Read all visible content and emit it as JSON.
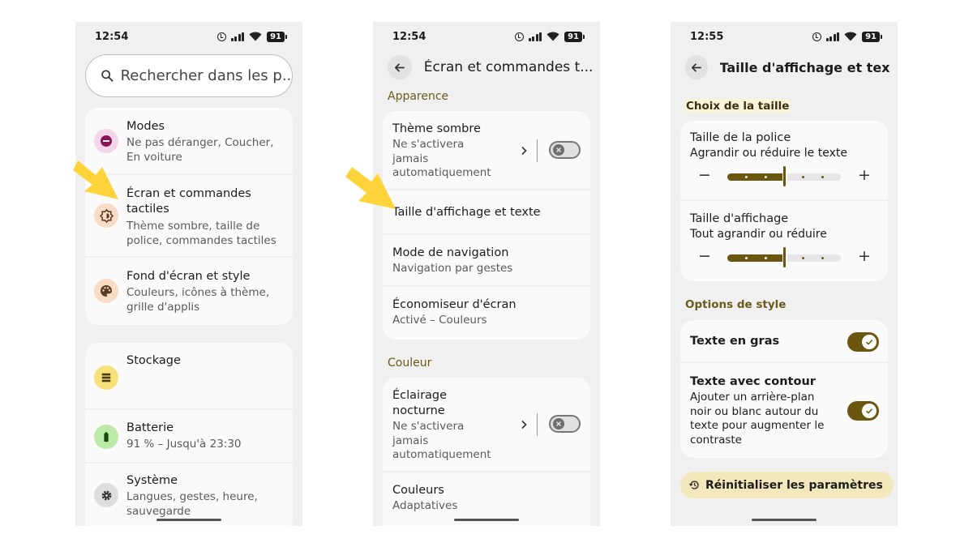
{
  "colors": {
    "accent": "#6b560f",
    "arrow": "#ffd43b",
    "section": "#6b5a1a",
    "highlight": "#fbf4dd"
  },
  "status": [
    {
      "time": "12:54",
      "battery": "91"
    },
    {
      "time": "12:54",
      "battery": "91"
    },
    {
      "time": "12:55",
      "battery": "91"
    }
  ],
  "screen1": {
    "search_placeholder": "Rechercher dans les p...",
    "items": [
      {
        "title": "Modes",
        "subtitle": "Ne pas déranger, Coucher, En voiture",
        "icon": "minus-circle-icon"
      },
      {
        "title": "Écran et commandes tactiles",
        "subtitle": "Thème sombre, taille de police, commandes tactiles",
        "icon": "brightness-icon"
      },
      {
        "title": "Fond d'écran et style",
        "subtitle": "Couleurs, icônes à thème, grille d'applis",
        "icon": "palette-icon"
      },
      {
        "title": "Stockage",
        "subtitle": "",
        "icon": "storage-icon"
      },
      {
        "title": "Batterie",
        "subtitle": "91 % – Jusqu'à 23:30",
        "icon": "battery-icon"
      },
      {
        "title": "Système",
        "subtitle": "Langues, gestes, heure, sauvegarde",
        "icon": "gear-icon"
      }
    ]
  },
  "screen2": {
    "title": "Écran et commandes t...",
    "section_appearance": "Apparence",
    "dark_theme": {
      "title": "Thème sombre",
      "subtitle": "Ne s'activera jamais automatiquement",
      "enabled": false
    },
    "display_size": {
      "title": "Taille d'affichage et texte"
    },
    "navigation": {
      "title": "Mode de navigation",
      "subtitle": "Navigation par gestes"
    },
    "screensaver": {
      "title": "Économiseur d'écran",
      "subtitle": "Activé – Couleurs"
    },
    "section_color": "Couleur",
    "night_light": {
      "title": "Éclairage nocturne",
      "subtitle": "Ne s'activera jamais automatiquement",
      "enabled": false
    },
    "colors": {
      "title": "Couleurs",
      "subtitle": "Adaptatives"
    }
  },
  "screen3": {
    "title": "Taille d'affichage et tex...",
    "section_size": "Choix de la taille",
    "font_size": {
      "title": "Taille de la police",
      "subtitle": "Agrandir ou réduire le texte",
      "level": 3,
      "max": 7,
      "minus": "−",
      "plus": "+"
    },
    "display_size": {
      "title": "Taille d'affichage",
      "subtitle": "Tout agrandir ou réduire",
      "level": 3,
      "max": 7,
      "minus": "−",
      "plus": "+"
    },
    "section_style": "Options de style",
    "bold_text": {
      "title": "Texte en gras",
      "enabled": true
    },
    "outline_text": {
      "title": "Texte avec contour",
      "subtitle": "Ajouter un arrière-plan noir ou blanc autour du texte pour augmenter le contraste",
      "enabled": true
    },
    "reset": "Réinitialiser les paramètres"
  }
}
